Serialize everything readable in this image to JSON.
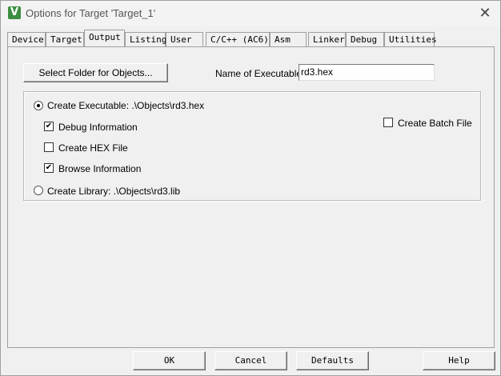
{
  "window": {
    "title": "Options for Target 'Target_1'",
    "close_glyph": "✕",
    "app_icon_glyph": "V"
  },
  "tabs": [
    {
      "label": "Device"
    },
    {
      "label": "Target"
    },
    {
      "label": "Output",
      "active": true
    },
    {
      "label": "Listing"
    },
    {
      "label": "User"
    },
    {
      "label": "C/C++ (AC6)"
    },
    {
      "label": "Asm"
    },
    {
      "label": "Linker"
    },
    {
      "label": "Debug"
    },
    {
      "label": "Utilities"
    }
  ],
  "output": {
    "select_folder_label": "Select Folder for Objects...",
    "name_exe_label": "Name of Executable:",
    "name_exe_value": "rd3.hex",
    "create_executable_label": "Create Executable:  .\\Objects\\rd3.hex",
    "debug_info_label": "Debug Information",
    "create_hex_label": "Create HEX File",
    "browse_info_label": "Browse Information",
    "create_library_label": "Create Library:  .\\Objects\\rd3.lib",
    "create_batch_label": "Create Batch File",
    "checked_mark": "✔"
  },
  "buttons": {
    "ok": "OK",
    "cancel": "Cancel",
    "defaults": "Defaults",
    "help": "Help"
  }
}
